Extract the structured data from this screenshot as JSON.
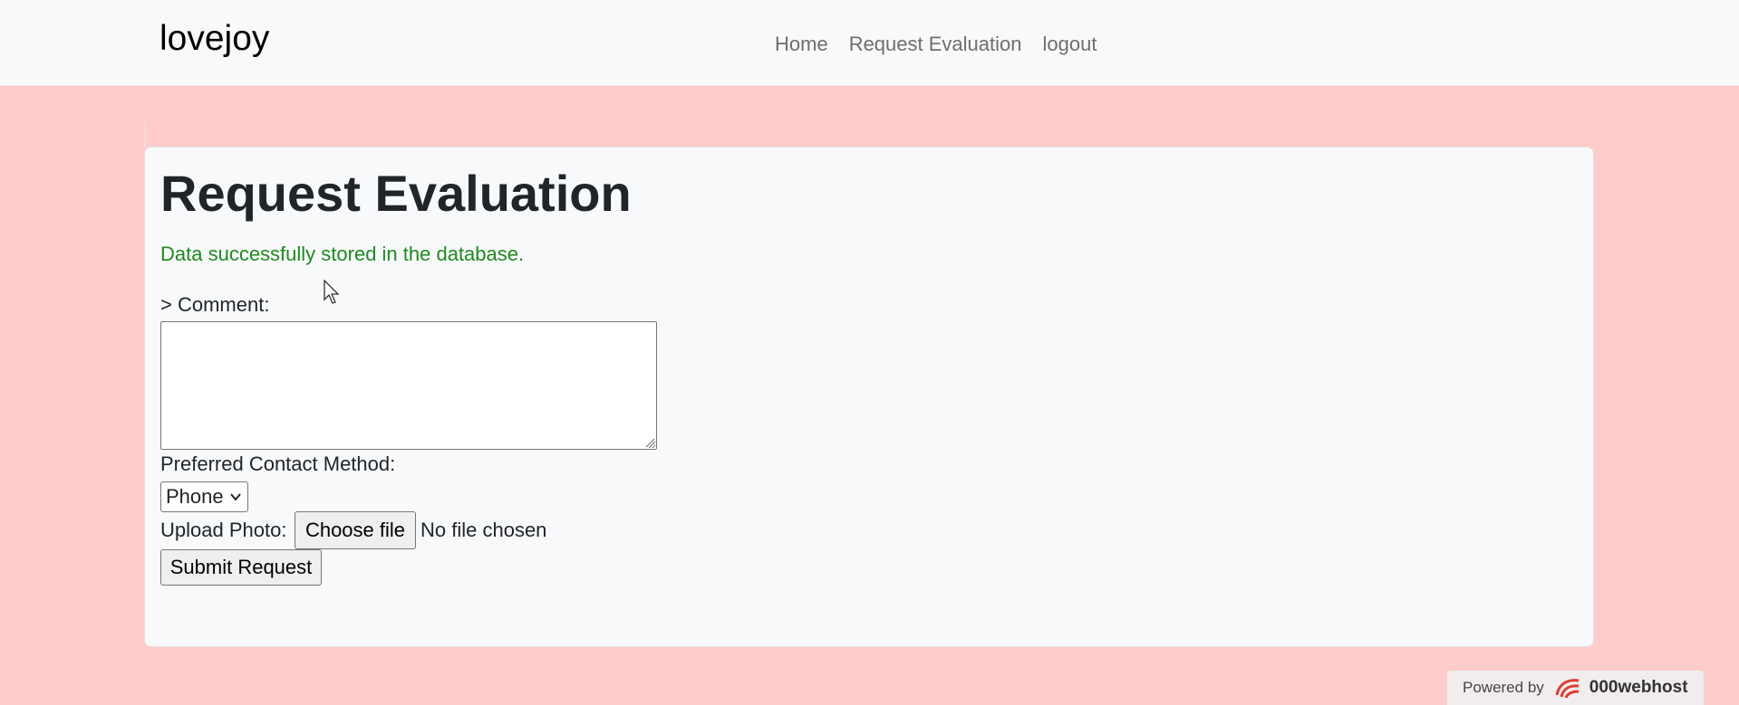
{
  "navbar": {
    "brand": "lovejoy",
    "links": [
      {
        "label": "Home"
      },
      {
        "label": "Request Evaluation"
      },
      {
        "label": "logout"
      }
    ]
  },
  "main": {
    "title": "Request Evaluation",
    "success_message": "Data successfully stored in the database.",
    "comment_label": "> Comment:",
    "comment_value": "",
    "contact_label": "Preferred Contact Method:",
    "contact_selected": "Phone",
    "upload_label": "Upload Photo:",
    "choose_file_label": "Choose file",
    "no_file_text": "No file chosen",
    "submit_label": "Submit Request"
  },
  "footer": {
    "powered_by": "Powered by",
    "host_name": "000webhost"
  },
  "colors": {
    "page_background": "#ffcccc",
    "navbar_background": "#f8f9fa",
    "success_text": "#1f8a1f",
    "host_logo_red": "#e03c31"
  },
  "icons": {
    "select_chevron": "chevron-down-icon",
    "resize_grip": "resize-grip-icon",
    "host_logo": "000webhost-logo-icon",
    "cursor": "mouse-pointer-icon"
  }
}
